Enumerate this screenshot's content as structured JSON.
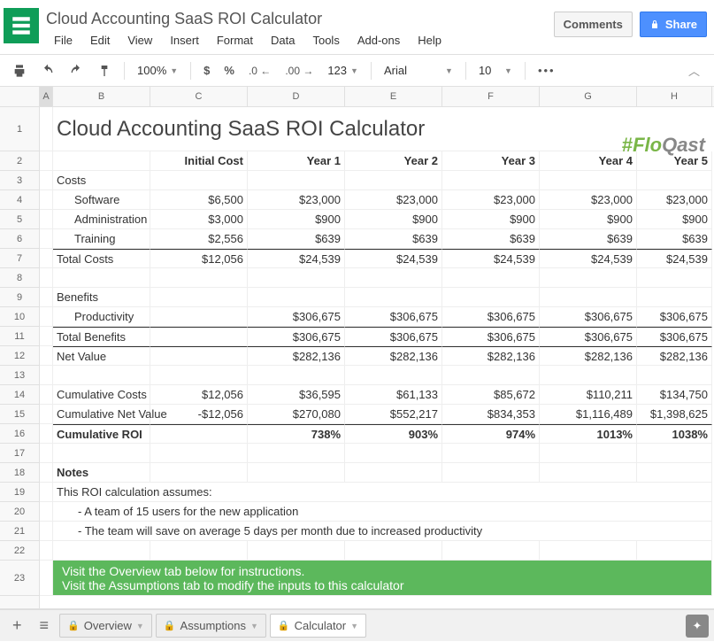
{
  "doc_title": "Cloud Accounting SaaS ROI Calculator",
  "menu": [
    "File",
    "Edit",
    "View",
    "Insert",
    "Format",
    "Data",
    "Tools",
    "Add-ons",
    "Help"
  ],
  "header_buttons": {
    "comments": "Comments",
    "share": "Share"
  },
  "toolbar": {
    "zoom": "100%",
    "format_123": "123",
    "font": "Arial",
    "font_size": "10"
  },
  "columns": [
    "A",
    "B",
    "C",
    "D",
    "E",
    "F",
    "G",
    "H"
  ],
  "row_numbers": [
    "1",
    "2",
    "3",
    "4",
    "5",
    "6",
    "7",
    "8",
    "9",
    "10",
    "11",
    "12",
    "13",
    "14",
    "15",
    "16",
    "17",
    "18",
    "19",
    "20",
    "21",
    "22",
    "23"
  ],
  "sheet": {
    "title": "Cloud Accounting SaaS ROI Calculator",
    "brand": {
      "hash": "#",
      "flo": "Flo",
      "qast": "Qast"
    },
    "headers": {
      "initial": "Initial Cost",
      "y1": "Year 1",
      "y2": "Year 2",
      "y3": "Year 3",
      "y4": "Year 4",
      "y5": "Year 5"
    },
    "sections": {
      "costs": "Costs",
      "software": "Software",
      "software_v": [
        "$6,500",
        "$23,000",
        "$23,000",
        "$23,000",
        "$23,000",
        "$23,000"
      ],
      "admin": "Administration",
      "admin_v": [
        "$3,000",
        "$900",
        "$900",
        "$900",
        "$900",
        "$900"
      ],
      "training": "Training",
      "training_v": [
        "$2,556",
        "$639",
        "$639",
        "$639",
        "$639",
        "$639"
      ],
      "total_costs": "Total Costs",
      "total_costs_v": [
        "$12,056",
        "$24,539",
        "$24,539",
        "$24,539",
        "$24,539",
        "$24,539"
      ],
      "benefits": "Benefits",
      "productivity": "Productivity",
      "productivity_v": [
        "",
        "$306,675",
        "$306,675",
        "$306,675",
        "$306,675",
        "$306,675"
      ],
      "total_benefits": "Total Benefits",
      "total_benefits_v": [
        "",
        "$306,675",
        "$306,675",
        "$306,675",
        "$306,675",
        "$306,675"
      ],
      "net_value": "Net Value",
      "net_value_v": [
        "",
        "$282,136",
        "$282,136",
        "$282,136",
        "$282,136",
        "$282,136"
      ],
      "cum_costs": "Cumulative Costs",
      "cum_costs_v": [
        "$12,056",
        "$36,595",
        "$61,133",
        "$85,672",
        "$110,211",
        "$134,750"
      ],
      "cum_net": "Cumulative Net Value",
      "cum_net_v": [
        "-$12,056",
        "$270,080",
        "$552,217",
        "$834,353",
        "$1,116,489",
        "$1,398,625"
      ],
      "cum_roi": "Cumulative ROI",
      "cum_roi_v": [
        "",
        "738%",
        "903%",
        "974%",
        "1013%",
        "1038%"
      ]
    },
    "notes": {
      "heading": "Notes",
      "intro": "This ROI calculation assumes:",
      "b1": "- A team of 15 users for the new application",
      "b2": "- The team will save on average 5 days per month due to increased productivity"
    },
    "callout": {
      "l1": "Visit the Overview tab below for instructions.",
      "l2": "Visit the Assumptions tab to modify the inputs to this calculator"
    }
  },
  "tabs": [
    "Overview",
    "Assumptions",
    "Calculator"
  ]
}
